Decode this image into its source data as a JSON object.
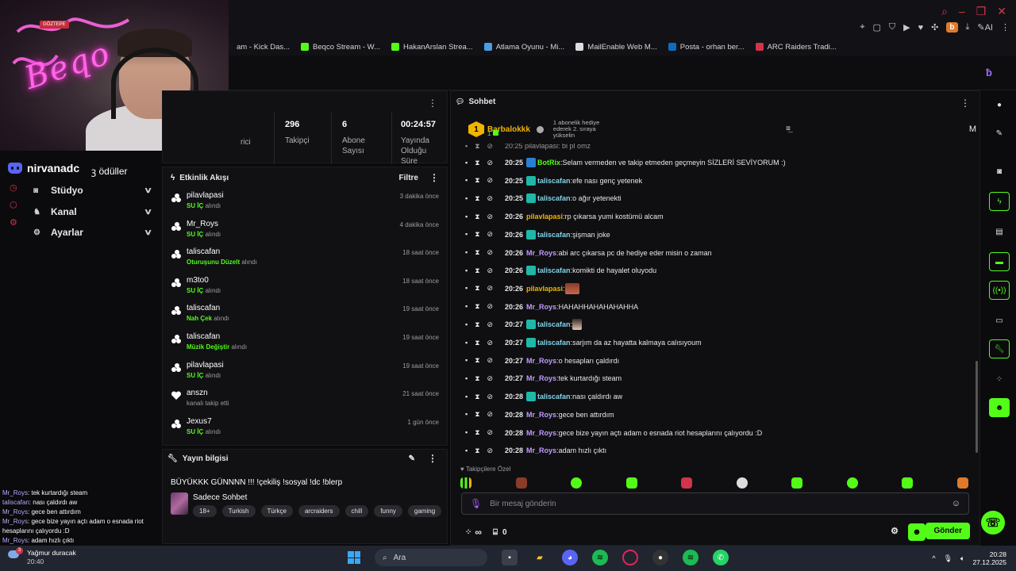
{
  "browser": {
    "bookmarks": [
      {
        "label": "am - Kick Das...",
        "icon": "kick-icon",
        "color": "#53fc18"
      },
      {
        "label": "Beqco Stream - W...",
        "icon": "kick-icon",
        "color": "#53fc18"
      },
      {
        "label": "HakanArslan Strea...",
        "icon": "kick-icon",
        "color": "#53fc18"
      },
      {
        "label": "Atlama Oyunu - Mi...",
        "icon": "globe-icon",
        "color": "#4a9de0"
      },
      {
        "label": "MailEnable Web M...",
        "icon": "mail-icon",
        "color": "#dddddd"
      },
      {
        "label": "Posta - orhan ber...",
        "icon": "outlook-icon",
        "color": "#0f6cbd"
      },
      {
        "label": "ARC Raiders Tradi...",
        "icon": "arc-icon",
        "color": "#d2344a"
      }
    ],
    "ext_badge": "b",
    "ai_label": "AI"
  },
  "webcam": {
    "sign_text": "GÖZTEPE",
    "neon_text": "Beqo"
  },
  "sidebar": {
    "discord_name": "nirvanadc",
    "rewards_label": "ödüller",
    "nav": [
      {
        "label": "Stüdyo",
        "icon": "camera-icon",
        "glyph": "◙"
      },
      {
        "label": "Kanal",
        "icon": "users-icon",
        "glyph": "♞"
      },
      {
        "label": "Ayarlar",
        "icon": "gear-icon",
        "glyph": "⚙"
      }
    ]
  },
  "stats": {
    "partial_label": "rici",
    "items": [
      {
        "value": "296",
        "label": "Takipçi"
      },
      {
        "value": "6",
        "label": "Abone Sayısı"
      },
      {
        "value": "00:24:57",
        "label": "Yayında Olduğu Süre"
      }
    ]
  },
  "activity": {
    "title": "Etkinlik Akışı",
    "filter_label": "Filtre",
    "items": [
      {
        "name": "pilavlapasi",
        "reward": "SU İÇ",
        "suffix": "alındı",
        "time": "3 dakika önce",
        "icon": "reward-icon"
      },
      {
        "name": "Mr_Roys",
        "reward": "SU İÇ",
        "suffix": "alındı",
        "time": "4 dakika önce",
        "icon": "reward-icon"
      },
      {
        "name": "taliscafan",
        "reward": "Oturuşunu Düzelt",
        "suffix": "alındı",
        "time": "18 saat önce",
        "icon": "reward-icon"
      },
      {
        "name": "m3to0",
        "reward": "SU İÇ",
        "suffix": "alındı",
        "time": "18 saat önce",
        "icon": "reward-icon"
      },
      {
        "name": "taliscafan",
        "reward": "Nah Çek",
        "suffix": "alındı",
        "time": "19 saat önce",
        "icon": "reward-icon"
      },
      {
        "name": "taliscafan",
        "reward": "Müzik Değiştir",
        "suffix": "alındı",
        "time": "19 saat önce",
        "icon": "reward-icon"
      },
      {
        "name": "pilavlapasi",
        "reward": "SU İÇ",
        "suffix": "alındı",
        "time": "19 saat önce",
        "icon": "reward-icon"
      },
      {
        "name": "anszn",
        "reward": "",
        "suffix": "kanalı takip etti",
        "time": "21 saat önce",
        "icon": "heart-icon"
      },
      {
        "name": "Jexus7",
        "reward": "SU İÇ",
        "suffix": "alındı",
        "time": "1 gün önce",
        "icon": "reward-icon"
      }
    ]
  },
  "stream_info": {
    "header": "Yayın bilgisi",
    "title": "BÜYÜKKK GÜNNNN !!! !çekiliş !sosyal !dc !blerp",
    "category": "Sadece Sohbet",
    "tags": [
      "18+",
      "Turkish",
      "Türkçe",
      "arcraiders",
      "chill",
      "funny",
      "gaming"
    ]
  },
  "chat": {
    "header": "Sohbet",
    "pinned": {
      "rank": "1",
      "user": "Barbalokkk",
      "count": "1",
      "desc": "1 abonelik hediye ederek 2. sıraya yükselin"
    },
    "right_letter": "M",
    "partial_top": "20:25 pilavlapasi: bi pl omz",
    "messages": [
      {
        "time": "20:25",
        "user": "BotRix",
        "color": "#53fc18",
        "badge": "#2a7fd4",
        "text": "Selam vermeden ve takip etmeden geçmeyin SİZLERİ SEVİYORUM :)",
        "emote": ""
      },
      {
        "time": "20:25",
        "user": "taliscafan",
        "color": "#7fd4e8",
        "badge": "#1fb8a8",
        "text": "efe nası genç yetenek",
        "emote": ""
      },
      {
        "time": "20:25",
        "user": "taliscafan",
        "color": "#7fd4e8",
        "badge": "#1fb8a8",
        "text": "o ağır yetenekti",
        "emote": ""
      },
      {
        "time": "20:26",
        "user": "pilavlapasi",
        "color": "#f0b400",
        "badge": "",
        "text": "rp çıkarsa yumi kostümü alcam",
        "emote": ""
      },
      {
        "time": "20:26",
        "user": "taliscafan",
        "color": "#7fd4e8",
        "badge": "#1fb8a8",
        "text": "şişman joke",
        "emote": ""
      },
      {
        "time": "20:26",
        "user": "Mr_Roys",
        "color": "#c39bff",
        "badge": "",
        "text": "abi arc çıkarsa pc de hediye eder misin o zaman",
        "emote": ""
      },
      {
        "time": "20:26",
        "user": "taliscafan",
        "color": "#7fd4e8",
        "badge": "#1fb8a8",
        "text": "komikti de hayalet oluyodu",
        "emote": ""
      },
      {
        "time": "20:26",
        "user": "pilavlapasi",
        "color": "#f0b400",
        "badge": "",
        "text": "",
        "emote": "face"
      },
      {
        "time": "20:26",
        "user": "Mr_Roys",
        "color": "#c39bff",
        "badge": "",
        "text": "HAHAHHAHAHAHAHHA",
        "emote": ""
      },
      {
        "time": "20:27",
        "user": "taliscafan",
        "color": "#7fd4e8",
        "badge": "#1fb8a8",
        "text": "",
        "emote": "small"
      },
      {
        "time": "20:27",
        "user": "taliscafan",
        "color": "#7fd4e8",
        "badge": "#1fb8a8",
        "text": "sarjım da az hayatta kalmaya calısıyoum",
        "emote": ""
      },
      {
        "time": "20:27",
        "user": "Mr_Roys",
        "color": "#c39bff",
        "badge": "",
        "text": "o hesapları çaldırdı",
        "emote": ""
      },
      {
        "time": "20:27",
        "user": "Mr_Roys",
        "color": "#c39bff",
        "badge": "",
        "text": "tek kurtardığı steam",
        "emote": ""
      },
      {
        "time": "20:28",
        "user": "taliscafan",
        "color": "#7fd4e8",
        "badge": "#1fb8a8",
        "text": "nası çaldırdı aw",
        "emote": ""
      },
      {
        "time": "20:28",
        "user": "Mr_Roys",
        "color": "#c39bff",
        "badge": "",
        "text": "gece ben attırdım",
        "emote": ""
      },
      {
        "time": "20:28",
        "user": "Mr_Roys",
        "color": "#c39bff",
        "badge": "",
        "text": "gece bize yayın açtı adam o esnada riot hesaplarını çalıyordu :D",
        "emote": ""
      },
      {
        "time": "20:28",
        "user": "Mr_Roys",
        "color": "#c39bff",
        "badge": "",
        "text": "adam hızlı çıktı",
        "emote": ""
      }
    ],
    "follower_label": "Takipçilere Özel",
    "input_placeholder": "Bir mesaj gönderin",
    "points_value": "0",
    "send_label": "Gönder"
  },
  "overlay_chat": [
    {
      "user": "Mr_Roys",
      "text": "tek kurtardığı steam"
    },
    {
      "user": "taliscafan",
      "text": "nası çaldırdı aw"
    },
    {
      "user": "Mr_Roys",
      "text": "gece ben attırdım"
    },
    {
      "user": "Mr_Roys",
      "text": "gece bize yayın açtı adam o esnada riot hesaplarını çalıyordu :D"
    },
    {
      "user": "Mr_Roys",
      "text": "adam hızlı çıktı"
    }
  ],
  "taskbar": {
    "weather_title": "Yağmur duracak",
    "weather_time": "20:40",
    "weather_badge": "3",
    "search_label": "Ara",
    "clock_time": "20:28",
    "clock_date": "27.12.2025"
  },
  "colors": {
    "accent": "#53fc18",
    "panel": "#111114",
    "background": "#0b0b0d"
  }
}
